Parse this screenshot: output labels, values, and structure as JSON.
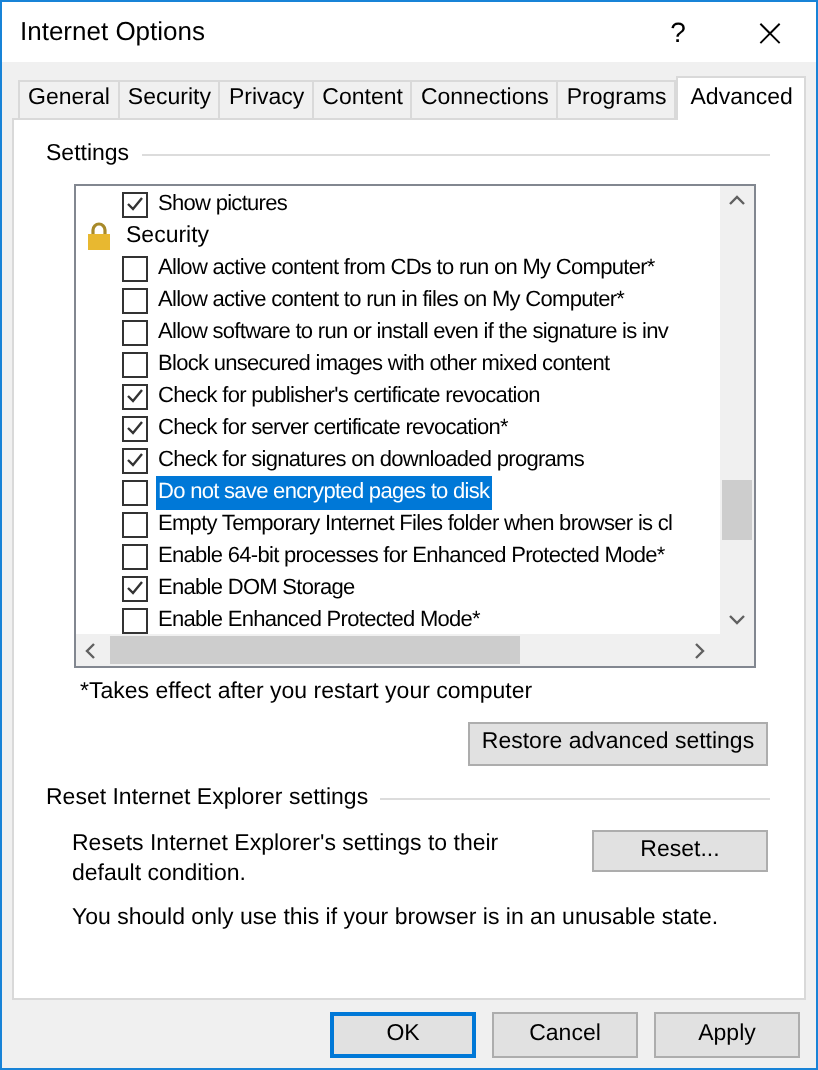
{
  "window": {
    "title": "Internet Options",
    "help": "?",
    "close": "×"
  },
  "tabs": [
    {
      "label": "General",
      "selected": false
    },
    {
      "label": "Security",
      "selected": false
    },
    {
      "label": "Privacy",
      "selected": false
    },
    {
      "label": "Content",
      "selected": false
    },
    {
      "label": "Connections",
      "selected": false
    },
    {
      "label": "Programs",
      "selected": false
    },
    {
      "label": "Advanced",
      "selected": true
    }
  ],
  "settings": {
    "heading": "Settings",
    "items": [
      {
        "kind": "checkbox",
        "label": "Show pictures",
        "checked": true,
        "selected": false
      },
      {
        "kind": "group",
        "label": "Security"
      },
      {
        "kind": "checkbox",
        "label": "Allow active content from CDs to run on My Computer*",
        "checked": false,
        "selected": false
      },
      {
        "kind": "checkbox",
        "label": "Allow active content to run in files on My Computer*",
        "checked": false,
        "selected": false
      },
      {
        "kind": "checkbox",
        "label": "Allow software to run or install even if the signature is inv",
        "checked": false,
        "selected": false
      },
      {
        "kind": "checkbox",
        "label": "Block unsecured images with other mixed content",
        "checked": false,
        "selected": false
      },
      {
        "kind": "checkbox",
        "label": "Check for publisher's certificate revocation",
        "checked": true,
        "selected": false
      },
      {
        "kind": "checkbox",
        "label": "Check for server certificate revocation*",
        "checked": true,
        "selected": false
      },
      {
        "kind": "checkbox",
        "label": "Check for signatures on downloaded programs",
        "checked": true,
        "selected": false
      },
      {
        "kind": "checkbox",
        "label": "Do not save encrypted pages to disk",
        "checked": false,
        "selected": true
      },
      {
        "kind": "checkbox",
        "label": "Empty Temporary Internet Files folder when browser is cl",
        "checked": false,
        "selected": false
      },
      {
        "kind": "checkbox",
        "label": "Enable 64-bit processes for Enhanced Protected Mode*",
        "checked": false,
        "selected": false
      },
      {
        "kind": "checkbox",
        "label": "Enable DOM Storage",
        "checked": true,
        "selected": false
      },
      {
        "kind": "checkbox",
        "label": "Enable Enhanced Protected Mode*",
        "checked": false,
        "selected": false
      }
    ],
    "footnote": "*Takes effect after you restart your computer",
    "restore_button": "Restore advanced settings"
  },
  "reset": {
    "heading": "Reset Internet Explorer settings",
    "description": "Resets Internet Explorer's settings to their default condition.",
    "button": "Reset...",
    "warning": "You should only use this if your browser is in an unusable state."
  },
  "buttons": [
    {
      "label": "OK",
      "default": true
    },
    {
      "label": "Cancel",
      "default": false
    },
    {
      "label": "Apply",
      "default": false
    }
  ]
}
